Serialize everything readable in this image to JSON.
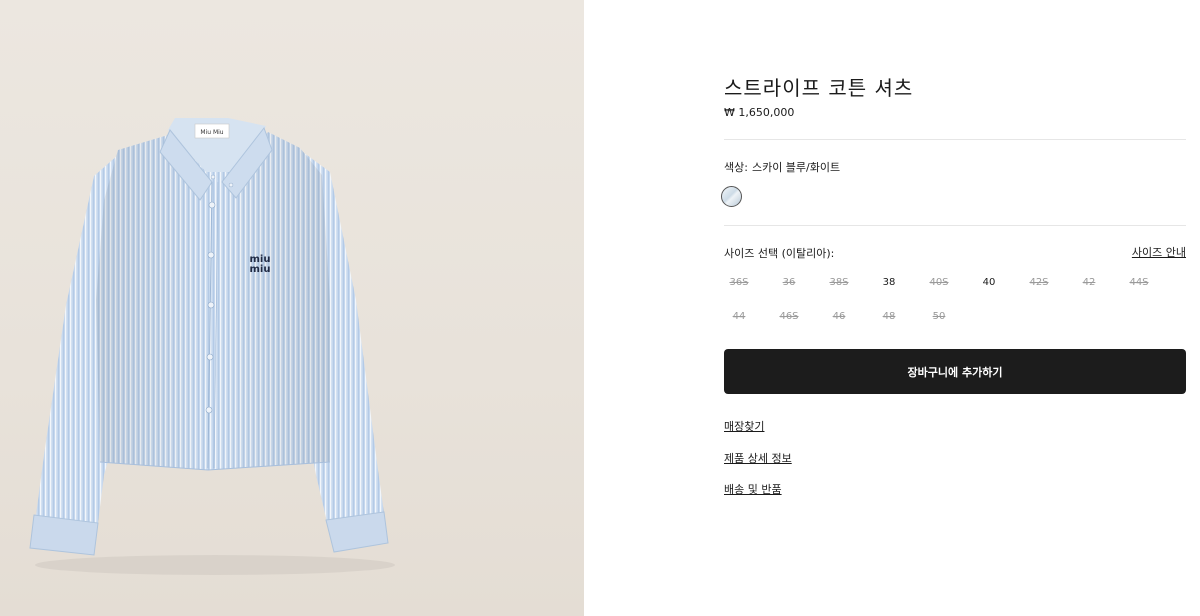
{
  "product": {
    "title": "스트라이프 코튼 셔츠",
    "price": "₩ 1,650,000",
    "image_icon": "striped-shirt-image",
    "shirt_logo_line1": "miu",
    "shirt_logo_line2": "miu",
    "shirt_label_text": "Miu Miu"
  },
  "color": {
    "label": "색상:",
    "value": "스카이 블루/화이트",
    "swatch_color": "#cddbe6"
  },
  "size": {
    "label": "사이즈 선택 (이탈리아):",
    "guide_label": "사이즈 안내",
    "rows": [
      [
        {
          "label": "36S",
          "available": false
        },
        {
          "label": "36",
          "available": false
        },
        {
          "label": "38S",
          "available": false
        },
        {
          "label": "38",
          "available": true
        },
        {
          "label": "40S",
          "available": false
        },
        {
          "label": "40",
          "available": true
        },
        {
          "label": "42S",
          "available": false
        },
        {
          "label": "42",
          "available": false
        },
        {
          "label": "44S",
          "available": false
        }
      ],
      [
        {
          "label": "44",
          "available": false
        },
        {
          "label": "46S",
          "available": false
        },
        {
          "label": "46",
          "available": false
        },
        {
          "label": "48",
          "available": false
        },
        {
          "label": "50",
          "available": false
        }
      ]
    ]
  },
  "actions": {
    "add_to_cart": "장바구니에 추가하기"
  },
  "links": {
    "find_store": "매장찾기",
    "product_details": "제품 상세 정보",
    "shipping_returns": "배송 및 반품"
  },
  "colors": {
    "button_bg": "#1c1c1c",
    "image_bg": "#ece7e0",
    "shirt_blue": "#c3d6ec",
    "unavailable_text": "#9a9a9a"
  }
}
